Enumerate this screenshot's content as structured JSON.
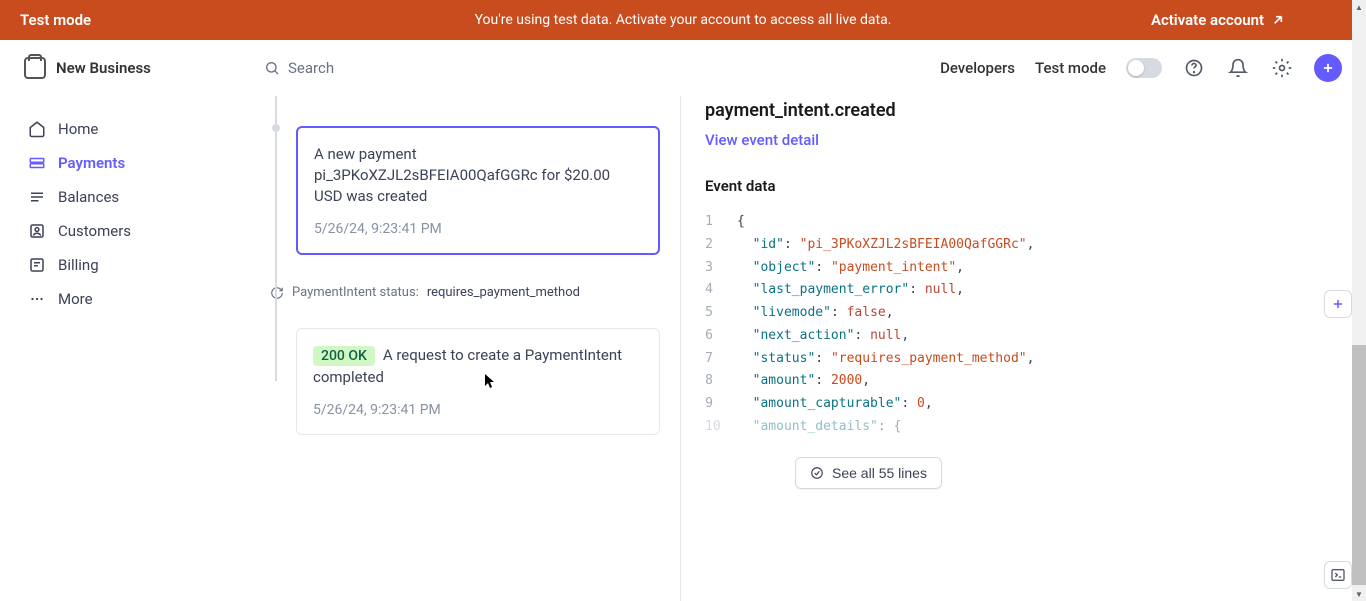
{
  "banner": {
    "left": "Test mode",
    "center": "You're using test data. Activate your account to access all live data.",
    "right": "Activate account"
  },
  "business": {
    "name": "New Business"
  },
  "search": {
    "placeholder": "Search"
  },
  "topbar": {
    "developers": "Developers",
    "test_mode": "Test mode"
  },
  "nav": {
    "home": "Home",
    "payments": "Payments",
    "balances": "Balances",
    "customers": "Customers",
    "billing": "Billing",
    "more": "More"
  },
  "timeline": {
    "event1": {
      "title": "A new payment pi_3PKoXZJL2sBFEIA00QafGGRc for $20.00 USD was created",
      "ts": "5/26/24, 9:23:41 PM"
    },
    "status": {
      "label": "PaymentIntent status:",
      "value": "requires_payment_method"
    },
    "request": {
      "badge": "200 OK",
      "title": "A request to create a PaymentIntent completed",
      "ts": "5/26/24, 9:23:41 PM"
    }
  },
  "detail": {
    "event_name": "payment_intent.created",
    "view_link": "View event detail",
    "event_data_label": "Event data",
    "see_all": "See all 55 lines",
    "code": {
      "id_key": "\"id\"",
      "id_val": "\"pi_3PKoXZJL2sBFEIA00QafGGRc\"",
      "object_key": "\"object\"",
      "object_val": "\"payment_intent\"",
      "lpe_key": "\"last_payment_error\"",
      "lpe_val": "null",
      "livemode_key": "\"livemode\"",
      "livemode_val": "false",
      "na_key": "\"next_action\"",
      "na_val": "null",
      "status_key": "\"status\"",
      "status_val": "\"requires_payment_method\"",
      "amount_key": "\"amount\"",
      "amount_val": "2000",
      "ac_key": "\"amount_capturable\"",
      "ac_val": "0",
      "ad_key": "\"amount_details\"",
      "ad_val": "{",
      "ln1": "1",
      "ln2": "2",
      "ln3": "3",
      "ln4": "4",
      "ln5": "5",
      "ln6": "6",
      "ln7": "7",
      "ln8": "8",
      "ln9": "9",
      "ln10": "10"
    }
  }
}
